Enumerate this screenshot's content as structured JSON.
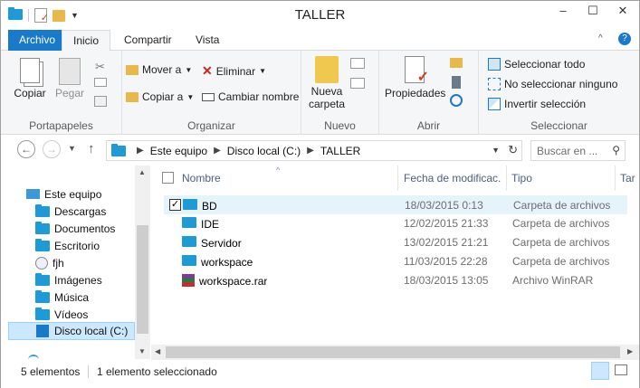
{
  "window": {
    "title": "TALLER"
  },
  "titlebar": {
    "minimize": "–",
    "maximize": "☐",
    "close": "✕"
  },
  "ribbon_tabs": [
    "Archivo",
    "Inicio",
    "Compartir",
    "Vista"
  ],
  "ribbon": {
    "portapapeles": {
      "label": "Portapapeles",
      "copy": "Copiar",
      "paste": "Pegar"
    },
    "organizar": {
      "label": "Organizar",
      "move_to": "Mover a",
      "copy_to": "Copiar a",
      "delete": "Eliminar",
      "rename": "Cambiar nombre"
    },
    "nuevo": {
      "label": "Nuevo",
      "new_folder_1": "Nueva",
      "new_folder_2": "carpeta"
    },
    "abrir": {
      "label": "Abrir",
      "properties": "Propiedades"
    },
    "seleccionar": {
      "label": "Seleccionar",
      "select_all": "Seleccionar todo",
      "select_none": "No seleccionar ninguno",
      "invert": "Invertir selección"
    }
  },
  "address": {
    "breadcrumb": [
      "Este equipo",
      "Disco local (C:)",
      "TALLER"
    ],
    "search_placeholder": "Buscar en ..."
  },
  "nav": {
    "items": [
      {
        "label": "Este equipo"
      },
      {
        "label": "Descargas"
      },
      {
        "label": "Documentos"
      },
      {
        "label": "Escritorio"
      },
      {
        "label": "fjh"
      },
      {
        "label": "Imágenes"
      },
      {
        "label": "Música"
      },
      {
        "label": "Vídeos"
      },
      {
        "label": "Disco local (C:)"
      }
    ]
  },
  "columns": {
    "name": "Nombre",
    "date": "Fecha de modificac...",
    "type": "Tipo",
    "size": "Tar"
  },
  "files": [
    {
      "name": "BD",
      "date": "18/03/2015 0:13",
      "type": "Carpeta de archivos",
      "icon": "folder-icon"
    },
    {
      "name": "IDE",
      "date": "12/02/2015 21:33",
      "type": "Carpeta de archivos",
      "icon": "folder-icon"
    },
    {
      "name": "Servidor",
      "date": "13/02/2015 21:21",
      "type": "Carpeta de archivos",
      "icon": "folder-icon"
    },
    {
      "name": "workspace",
      "date": "11/03/2015 22:28",
      "type": "Carpeta de archivos",
      "icon": "folder-icon"
    },
    {
      "name": "workspace.rar",
      "date": "18/03/2015 13:05",
      "type": "Archivo WinRAR",
      "icon": "winrar-icon"
    }
  ],
  "status": {
    "count": "5 elementos",
    "selected": "1 elemento seleccionado"
  },
  "colors": {
    "accent": "#1979ca",
    "folder": "#1e9ad6",
    "selection": "#e5f3fb"
  }
}
